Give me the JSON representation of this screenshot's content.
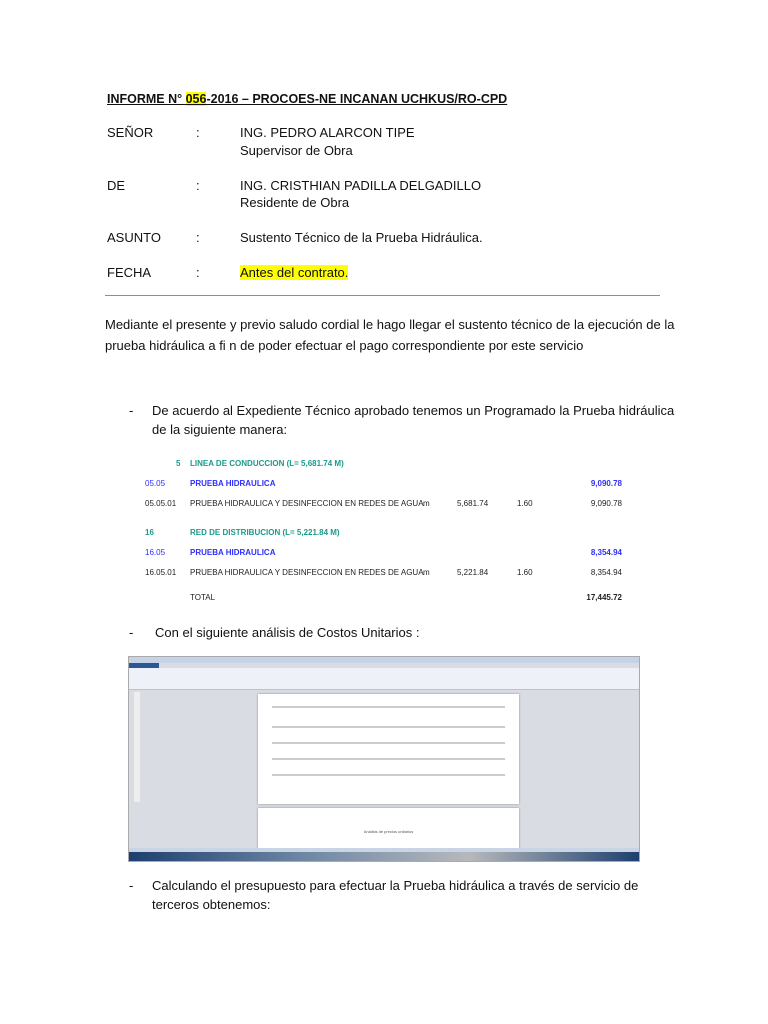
{
  "title": {
    "prefix": "INFORME N° ",
    "number": "056",
    "suffix": "-2016 – PROCOES-NE INCANAN UCHKUS/RO-CPD"
  },
  "header": [
    {
      "label": "SEÑOR",
      "sep": ":",
      "line1": "ING. PEDRO ALARCON TIPE",
      "line2": "Supervisor de Obra"
    },
    {
      "label": "DE",
      "sep": ":",
      "line1": "ING. CRISTHIAN PADILLA DELGADILLO",
      "line2": "Residente de Obra"
    },
    {
      "label": "ASUNTO",
      "sep": ":",
      "line1": "Sustento Técnico de la Prueba Hidráulica."
    },
    {
      "label": "FECHA",
      "sep": ":",
      "line1": "Antes del contrato."
    }
  ],
  "intro": [
    "Mediante el presente y previo saludo cordial le hago llegar el sustento técnico de la ejecución de la",
    "prueba hidráulica a fi n de poder efectuar el pago correspondiente por este servicio"
  ],
  "bullets": [
    {
      "dash": "-",
      "lines": [
        "De acuerdo al Expediente Técnico aprobado tenemos un Programado la Prueba hidráulica",
        "de la siguiente manera:"
      ]
    },
    {
      "dash": "-",
      "lines": [
        "Con el siguiente análisis de Costos Unitarios :"
      ]
    },
    {
      "dash": "-",
      "lines": [
        "Calculando el presupuesto para efectuar la Prueba hidráulica a través de servicio de",
        "terceros obtenemos:"
      ]
    }
  ],
  "budget": {
    "s1": {
      "code": "5",
      "title": "LINEA DE CONDUCCION (L= 5,681.74 M)"
    },
    "s1sub": {
      "code": "05.05",
      "title": "PRUEBA HIDRAULICA",
      "total": "9,090.78"
    },
    "s1item": {
      "code": "05.05.01",
      "desc": "PRUEBA HIDRAULICA Y DESINFECCION EN REDES DE AGUA",
      "unit": "m",
      "qty": "5,681.74",
      "price": "1.60",
      "total": "9,090.78"
    },
    "s2": {
      "code": "16",
      "title": "RED DE DISTRIBUCION (L= 5,221.84 M)"
    },
    "s2sub": {
      "code": "16.05",
      "title": "PRUEBA HIDRAULICA",
      "total": "8,354.94"
    },
    "s2item": {
      "code": "16.05.01",
      "desc": "PRUEBA HIDRAULICA Y DESINFECCION EN REDES DE AGUA",
      "unit": "m",
      "qty": "5,221.84",
      "price": "1.60",
      "total": "8,354.94"
    },
    "total": {
      "label": "TOTAL",
      "value": "17,445.72"
    }
  },
  "screenshot": {
    "doc_title": "Análisis de precios unitarios"
  }
}
